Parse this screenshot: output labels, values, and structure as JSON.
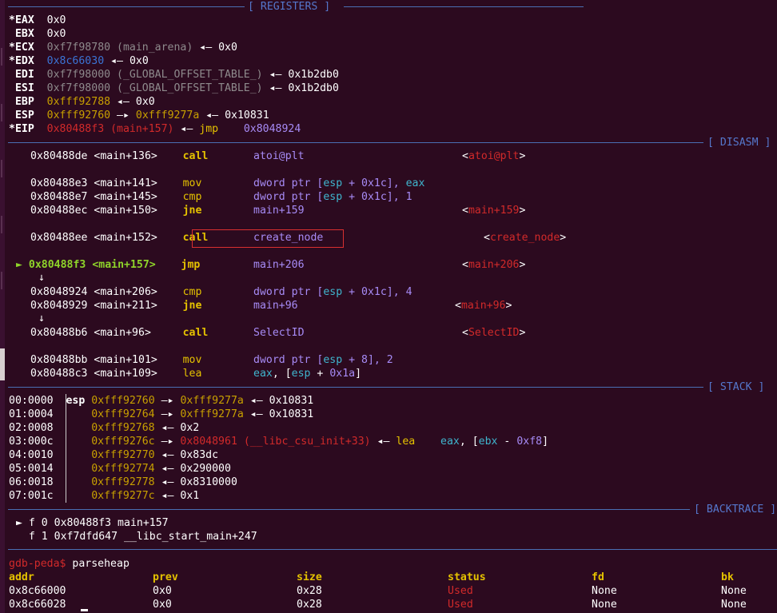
{
  "sections": {
    "registers": "[ REGISTERS ]",
    "disasm": "[ DISASM ]",
    "stack": "[ STACK ]",
    "backtrace": "[ BACKTRACE ]"
  },
  "registers": [
    {
      "mark": "*",
      "name": "EAX",
      "value": "0x0",
      "tail": ""
    },
    {
      "mark": " ",
      "name": "EBX",
      "value": "0x0",
      "tail": ""
    },
    {
      "mark": "*",
      "name": "ECX",
      "value": "0xf7f98780 (main_arena)",
      "tail": "0x0"
    },
    {
      "mark": "*",
      "name": "EDX",
      "value": "0x8c66030",
      "tail": "0x0"
    },
    {
      "mark": " ",
      "name": "EDI",
      "value": "0xf7f98000 (_GLOBAL_OFFSET_TABLE_)",
      "tail": "0x1b2db0"
    },
    {
      "mark": " ",
      "name": "ESI",
      "value": "0xf7f98000 (_GLOBAL_OFFSET_TABLE_)",
      "tail": "0x1b2db0"
    },
    {
      "mark": " ",
      "name": "EBP",
      "value": "0xfff92788",
      "tail": "0x0"
    },
    {
      "mark": " ",
      "name": "ESP",
      "value": "0xfff92760",
      "mid": "0xfff9277a",
      "tail": "0x10831"
    },
    {
      "mark": "*",
      "name": "EIP",
      "value": "0x80488f3 (main+157)",
      "tail": "jmp",
      "tail2": "0x8048924"
    }
  ],
  "disasm": [
    {
      "addr": "0x80488de",
      "sym": "<main+136>",
      "op": "call",
      "args": "atoi@plt",
      "ref": "<atoi@plt>"
    },
    {
      "addr": "0x80488e3",
      "sym": "<main+141>",
      "op": "mov",
      "args_a": "dword ptr [",
      "args_b": "esp",
      "args_c": " + ",
      "args_d": "0x1c",
      "args_e": "], ",
      "args_f": "eax"
    },
    {
      "addr": "0x80488e7",
      "sym": "<main+145>",
      "op": "cmp",
      "args_a": "dword ptr [",
      "args_b": "esp",
      "args_c": " + ",
      "args_d": "0x1c",
      "args_e": "], ",
      "args_f": "1"
    },
    {
      "addr": "0x80488ec",
      "sym": "<main+150>",
      "op": "jne",
      "args": "main+159",
      "ref": "<main+159>"
    },
    {
      "addr": "0x80488ee",
      "sym": "<main+152>",
      "op": "call",
      "args": "create_node",
      "ref": "<create_node>"
    },
    {
      "addr": "0x80488f3",
      "sym": "<main+157>",
      "op": "jmp",
      "args": "main+206",
      "ref": "<main+206>"
    },
    {
      "addr": "0x8048924",
      "sym": "<main+206>",
      "op": "cmp",
      "args_a": "dword ptr [",
      "args_b": "esp",
      "args_c": " + ",
      "args_d": "0x1c",
      "args_e": "], ",
      "args_f": "4"
    },
    {
      "addr": "0x8048929",
      "sym": "<main+211>",
      "op": "jne",
      "args": "main+96",
      "ref": "<main+96>"
    },
    {
      "addr": "0x80488b6",
      "sym": "<main+96>",
      "op": "call",
      "args": "SelectID",
      "ref": "<SelectID>"
    },
    {
      "addr": "0x80488bb",
      "sym": "<main+101>",
      "op": "mov",
      "args_a": "dword ptr [",
      "args_b": "esp",
      "args_c": " + ",
      "args_d": "8",
      "args_e": "], ",
      "args_f": "2"
    },
    {
      "addr": "0x80488c3",
      "sym": "<main+109>",
      "op": "lea",
      "args_a": "eax",
      "args_b": ", [",
      "args_c": "esp",
      "args_d": " + ",
      "args_e": "0x1a",
      "args_f": "]"
    }
  ],
  "current_marker": "►",
  "down_arrow": "↓",
  "stack": [
    {
      "off": "00:0000",
      "reg": "esp",
      "a": "0xfff92760",
      "b": "0xfff9277a",
      "c": "0x10831"
    },
    {
      "off": "01:0004",
      "reg": "",
      "a": "0xfff92764",
      "b": "0xfff9277a",
      "c": "0x10831"
    },
    {
      "off": "02:0008",
      "reg": "",
      "a": "0xfff92768",
      "c": "0x2"
    },
    {
      "off": "03:000c",
      "reg": "",
      "a": "0xfff9276c",
      "b": "0x8048961 (__libc_csu_init+33)",
      "c": "lea",
      "d": "eax",
      "e": ", [",
      "f": "ebx",
      "g": " - ",
      "h": "0xf8",
      "i": "]"
    },
    {
      "off": "04:0010",
      "reg": "",
      "a": "0xfff92770",
      "c": "0x83dc"
    },
    {
      "off": "05:0014",
      "reg": "",
      "a": "0xfff92774",
      "c": "0x290000"
    },
    {
      "off": "06:0018",
      "reg": "",
      "a": "0xfff92778",
      "c": "0x8310000"
    },
    {
      "off": "07:001c",
      "reg": "",
      "a": "0xfff9277c",
      "c": "0x1"
    }
  ],
  "backtrace": [
    {
      "mark": "►",
      "text": "f 0 0x80488f3 main+157"
    },
    {
      "mark": " ",
      "text": "f 1 0xf7dfd647 __libc_start_main+247"
    }
  ],
  "prompt": "gdb-peda$",
  "command": "parseheap",
  "heap": {
    "headers": [
      "addr",
      "prev",
      "size",
      "status",
      "fd",
      "bk"
    ],
    "rows": [
      [
        "0x8c66000",
        "0x0",
        "0x28",
        "Used",
        "None",
        "None"
      ],
      [
        "0x8c66028",
        "0x0",
        "0x28",
        "Used",
        "None",
        "None"
      ]
    ]
  },
  "arrows": {
    "left": "◂—",
    "right": "—▸"
  }
}
